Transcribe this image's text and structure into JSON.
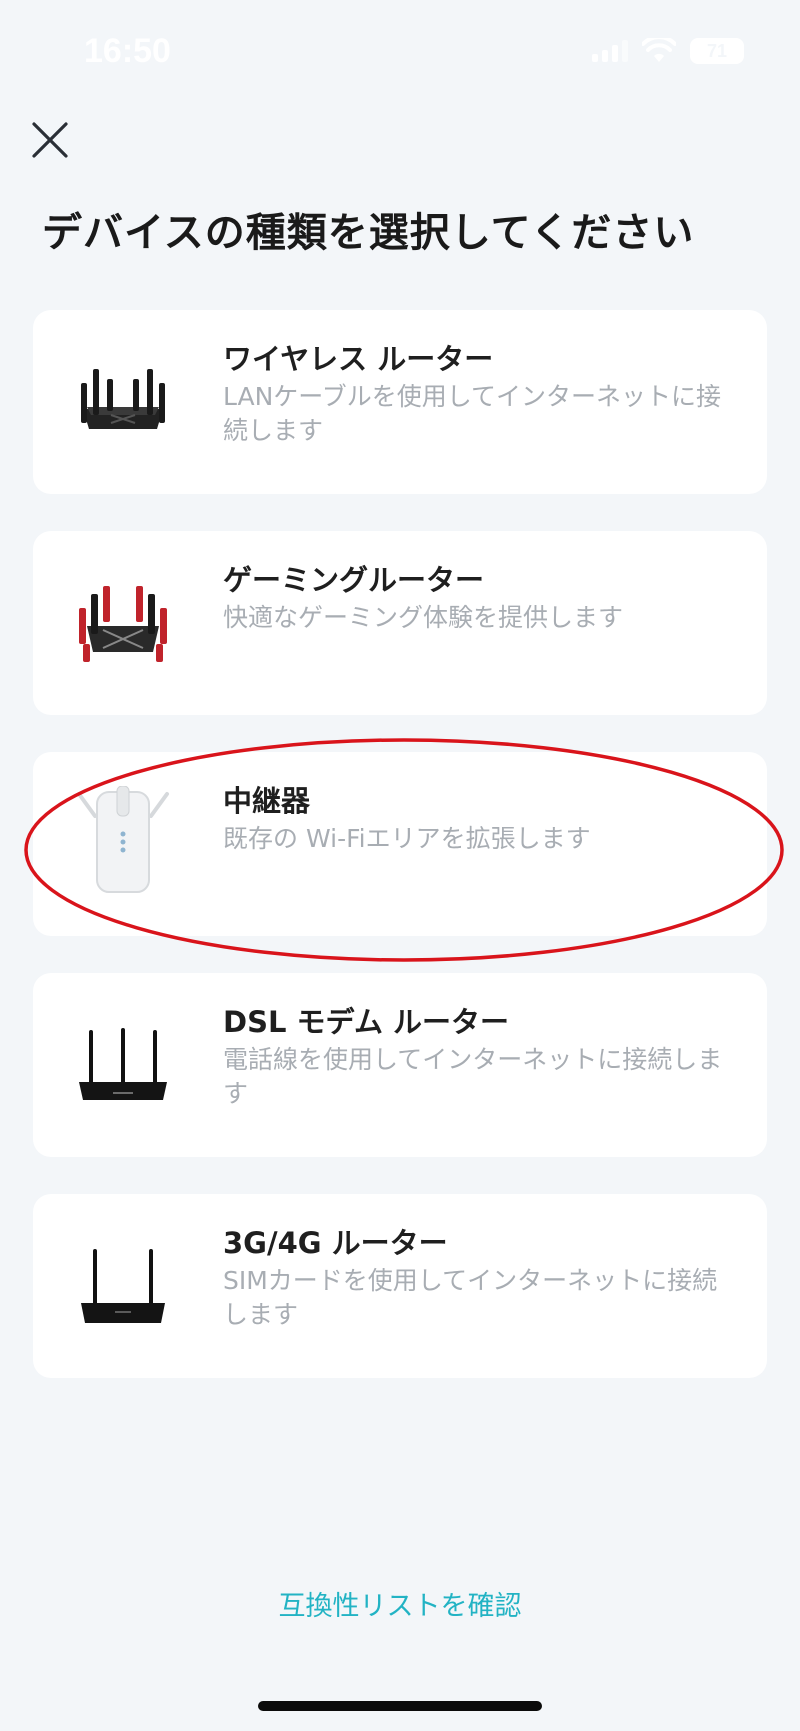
{
  "status_bar": {
    "time": "16:50",
    "battery": "71"
  },
  "title": "デバイスの種類を選択してください",
  "devices": [
    {
      "title": "ワイヤレス ルーター",
      "description": "LANケーブルを使用してインターネットに接続します",
      "image": "wireless-router-icon"
    },
    {
      "title": "ゲーミングルーター",
      "description": "快適なゲーミング体験を提供します",
      "image": "gaming-router-icon"
    },
    {
      "title": "中継器",
      "description": "既存の Wi-Fiエリアを拡張します",
      "image": "range-extender-icon"
    },
    {
      "title": "DSL モデム ルーター",
      "description": "電話線を使用してインターネットに接続します",
      "image": "dsl-modem-router-icon"
    },
    {
      "title": "3G/4G ルーター",
      "description": "SIMカードを使用してインターネットに接続します",
      "image": "lte-router-icon"
    }
  ],
  "compat_link": "互換性リストを確認",
  "colors": {
    "accent": "#22b3c4",
    "highlight": "#d9141b",
    "background": "#f3f6f9"
  }
}
